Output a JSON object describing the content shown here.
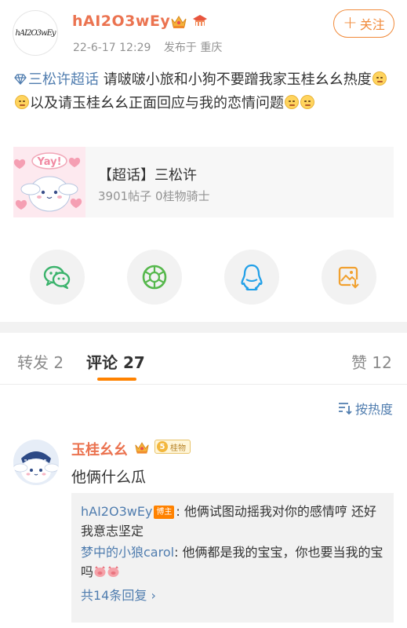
{
  "post": {
    "username": "hAI2O3wEy",
    "avatar_text": "hAI2O3wEy",
    "date": "22-6-17 12:29",
    "location": "发布于 重庆",
    "follow_label": "关注",
    "topic": "三松许超话",
    "text_1": " 请啵啵小旅和小狗不要蹭我家玉桂幺幺热度",
    "text_2": "以及请玉桂幺幺正面回应与我的恋情问题"
  },
  "topic_card": {
    "image_text": "Yay!",
    "title": "【超话】三松许",
    "stats": "3901帖子 0桂物骑士"
  },
  "share": {
    "icons": [
      "wechat-icon",
      "moments-icon",
      "qq-icon",
      "save-image-icon"
    ],
    "colors": {
      "wechat": "#3bb36c",
      "moments": "#56b84c",
      "qq": "#22a0e8",
      "save": "#f1a130"
    }
  },
  "tabs": {
    "repost": "转发 2",
    "comments": "评论 27",
    "likes": "赞 12"
  },
  "sort": {
    "label": "按热度"
  },
  "comment": {
    "name": "玉桂幺幺",
    "level": "5",
    "level_label": "桂物",
    "text": "他俩什么瓜",
    "replies": [
      {
        "name": "hAI2O3wEy",
        "tag": "博主",
        "text": ": 他俩试图动摇我对你的感情哼 还好我意志坚定"
      },
      {
        "name": "梦中的小狼carol",
        "text": ": 他俩都是我的宝宝，你也要当我的宝吗"
      }
    ],
    "more": "共14条回复 ›"
  },
  "colors": {
    "accent": "#ff8200",
    "link": "#507daf",
    "name": "#eb7350"
  }
}
